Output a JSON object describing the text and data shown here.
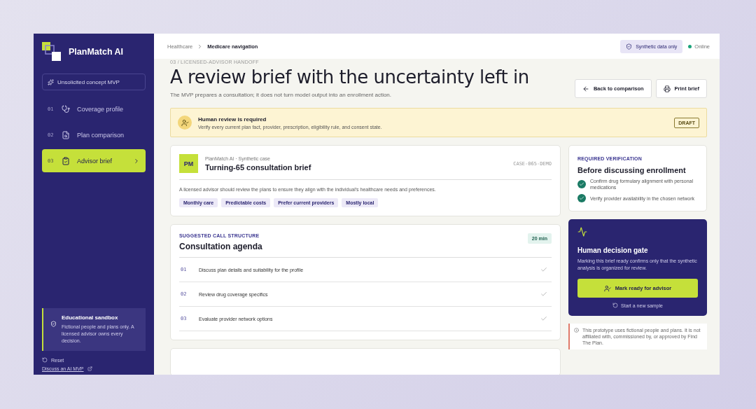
{
  "sidebar": {
    "brand": "PlanMatch AI",
    "concept": "Unsolicited concept MVP",
    "items": [
      {
        "number": "01",
        "label": "Coverage profile",
        "selected": false
      },
      {
        "number": "02",
        "label": "Plan comparison",
        "selected": false
      },
      {
        "number": "03",
        "label": "Advisor brief",
        "selected": true
      }
    ],
    "sandbox": {
      "title": "Educational sandbox",
      "text": "Fictional people and plans only. A licensed advisor owns every decision."
    },
    "reset": "Reset",
    "link": "Discuss an AI MVP"
  },
  "header": {
    "breadcrumb": [
      "Healthcare",
      "Medicare navigation"
    ],
    "badge": "Synthetic data only",
    "status": "Online"
  },
  "page": {
    "eyebrow": "03 / LICENSED-ADVISOR HANDOFF",
    "title": "A review brief with the uncertainty left in",
    "subtitle": "The MVP prepares a consultation; it does not turn model output into an enrollment action.",
    "buttons": [
      "Back to comparison",
      "Print brief"
    ]
  },
  "banner": {
    "title": "Human review is required",
    "text": "Verify every current plan fact, provider, prescription, eligibility rule, and consent state.",
    "tag": "DRAFT"
  },
  "brief": {
    "avatar": "PM",
    "source": "PlanMatch AI · Synthetic case",
    "title": "Turning-65 consultation brief",
    "case_id": "CASE-065-DEMO",
    "summary": "A licensed advisor should review the plans to ensure they align with the individual's healthcare needs and preferences.",
    "tags": [
      "Monthly care",
      "Predictable costs",
      "Prefer current providers",
      "Mostly local"
    ]
  },
  "agenda": {
    "eyebrow": "SUGGESTED CALL STRUCTURE",
    "title": "Consultation agenda",
    "duration": "20 min",
    "items": [
      {
        "number": "01",
        "text": "Discuss plan details and suitability for the profile"
      },
      {
        "number": "02",
        "text": "Review drug coverage specifics"
      },
      {
        "number": "03",
        "text": "Evaluate provider network options"
      }
    ]
  },
  "verification": {
    "eyebrow": "REQUIRED VERIFICATION",
    "title": "Before discussing enrollment",
    "items": [
      "Confirm drug formulary alignment with personal medications",
      "Verify provider availability in the chosen network"
    ]
  },
  "gate": {
    "title": "Human decision gate",
    "text": "Marking this brief ready confirms only that the synthetic analysis is organized for review.",
    "button": "Mark ready for advisor",
    "secondary": "Start a new sample"
  },
  "disclaimer": "This prototype uses fictional people and plans. It is not affiliated with, commissioned by, or approved by Find The Plan."
}
